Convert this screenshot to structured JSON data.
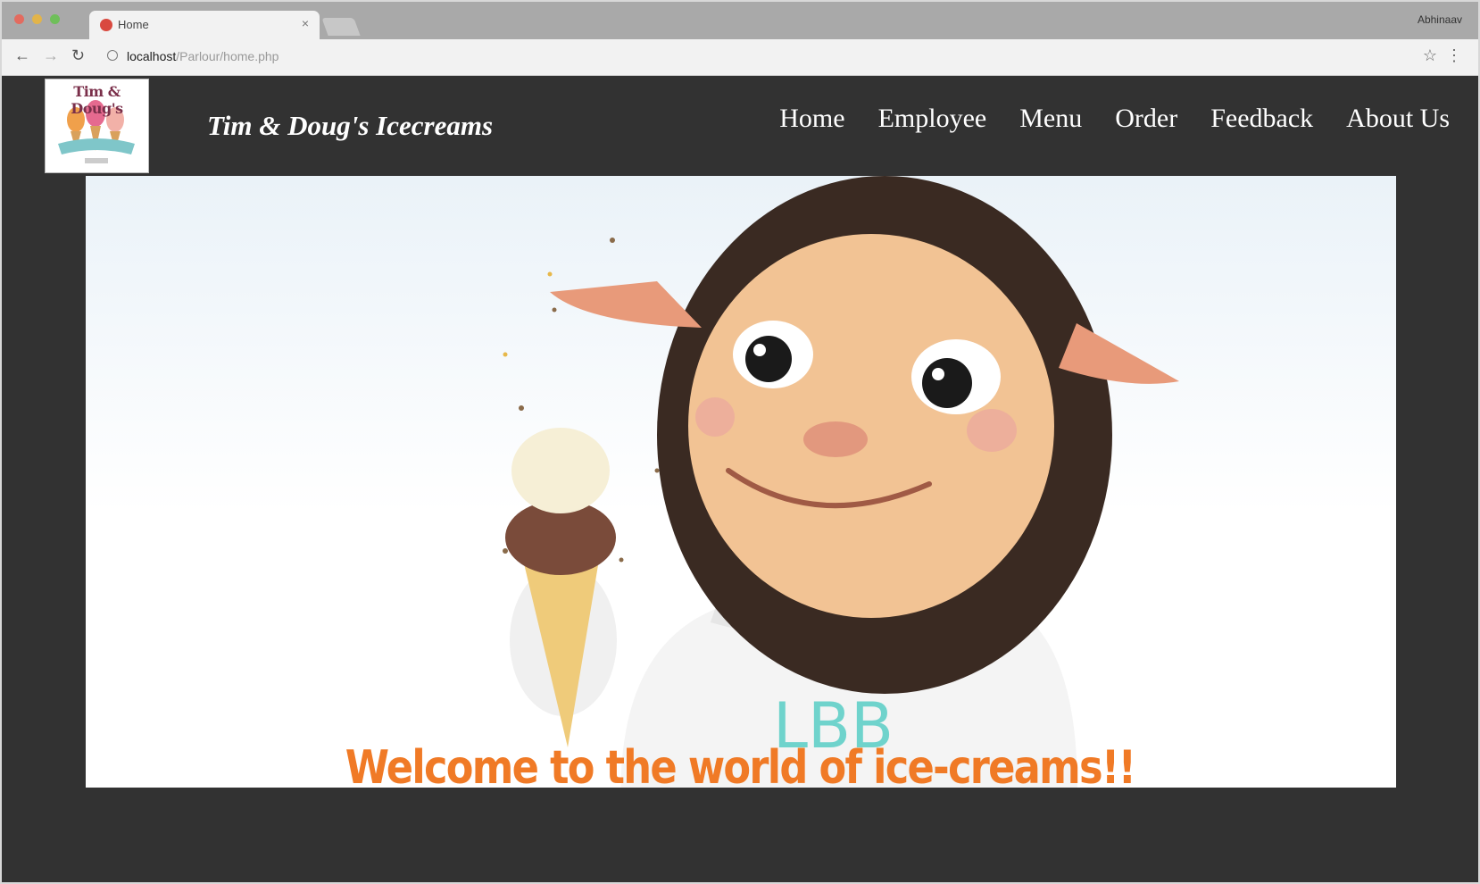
{
  "browser": {
    "tab_title": "Home",
    "tab_close": "×",
    "profile_name": "Abhinaav",
    "url_host": "localhost",
    "url_path": "/Parlour/home.php",
    "back_glyph": "←",
    "forward_glyph": "→",
    "reload_glyph": "↻",
    "star_glyph": "☆",
    "menu_glyph": "⋮"
  },
  "header": {
    "logo_text": "Tim & Doug's",
    "site_title": "Tim & Doug's Icecreams",
    "nav": [
      {
        "label": "Home"
      },
      {
        "label": "Employee"
      },
      {
        "label": "Menu"
      },
      {
        "label": "Order"
      },
      {
        "label": "Feedback"
      },
      {
        "label": "About Us"
      }
    ]
  },
  "hero": {
    "shirt_text": "LBB"
  },
  "headline": "Welcome to the world of ice-creams!!",
  "colors": {
    "page_bg": "#323232",
    "headline": "#f07a26",
    "shirt_text": "#6fd3cc"
  }
}
